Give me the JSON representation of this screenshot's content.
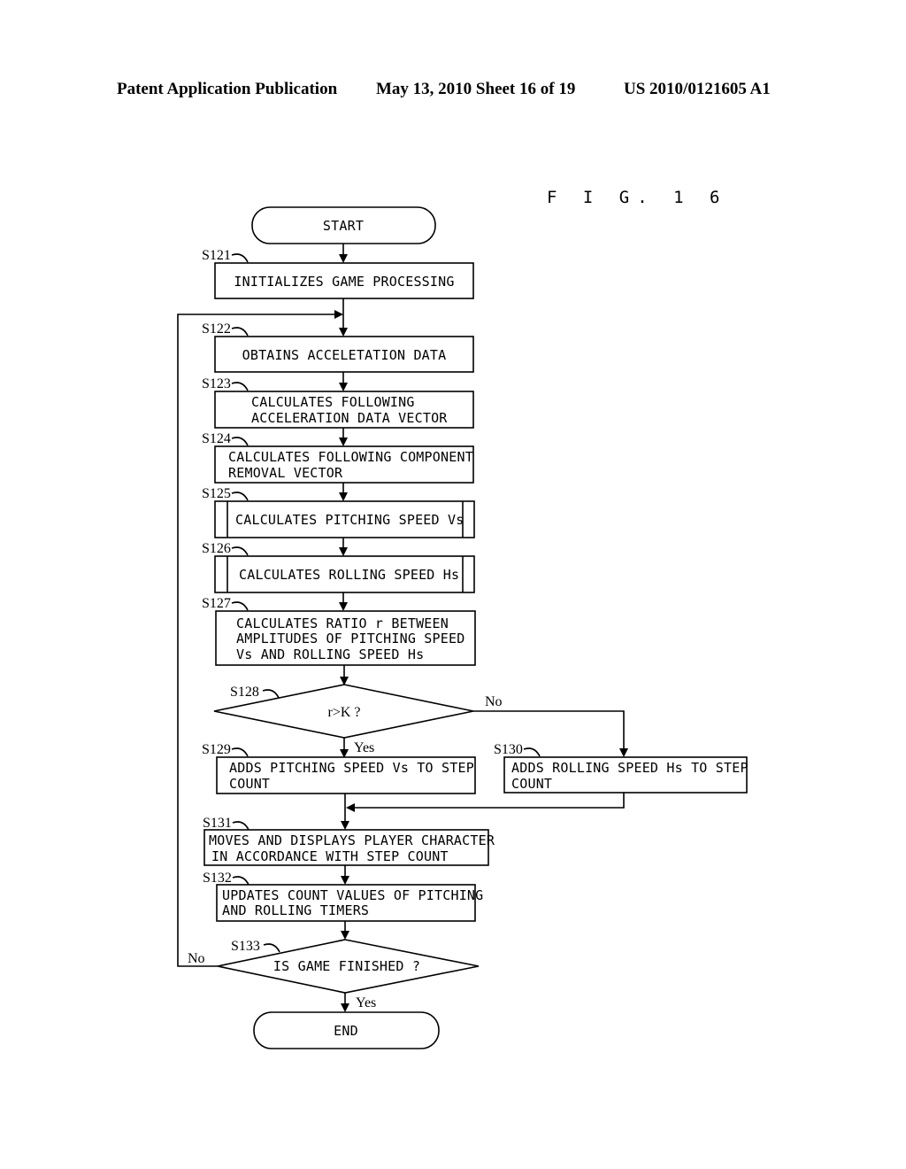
{
  "header": {
    "publication": "Patent Application Publication",
    "date_sheet": "May 13, 2010  Sheet 16 of 19",
    "number": "US 2010/0121605 A1"
  },
  "figure_label": "F I G. 1 6",
  "flowchart": {
    "start": "START",
    "end": "END",
    "steps": {
      "s121": {
        "id": "S121",
        "lines": [
          "INITIALIZES GAME PROCESSING"
        ]
      },
      "s122": {
        "id": "S122",
        "lines": [
          "OBTAINS ACCELETATION DATA"
        ]
      },
      "s123": {
        "id": "S123",
        "lines": [
          "CALCULATES FOLLOWING",
          "ACCELERATION DATA VECTOR"
        ]
      },
      "s124": {
        "id": "S124",
        "lines": [
          "CALCULATES FOLLOWING COMPONENT",
          "REMOVAL VECTOR"
        ]
      },
      "s125": {
        "id": "S125",
        "lines": [
          "CALCULATES PITCHING SPEED Vs"
        ]
      },
      "s126": {
        "id": "S126",
        "lines": [
          "CALCULATES ROLLING SPEED Hs"
        ]
      },
      "s127": {
        "id": "S127",
        "lines": [
          "CALCULATES RATIO r BETWEEN",
          "AMPLITUDES OF PITCHING SPEED",
          "Vs AND ROLLING SPEED Hs"
        ]
      },
      "s128": {
        "id": "S128",
        "lines": [
          "r>K ?"
        ]
      },
      "s129": {
        "id": "S129",
        "lines": [
          "ADDS PITCHING SPEED Vs TO STEP",
          "COUNT"
        ]
      },
      "s130": {
        "id": "S130",
        "lines": [
          "ADDS ROLLING SPEED Hs TO STEP",
          "COUNT"
        ]
      },
      "s131": {
        "id": "S131",
        "lines": [
          "MOVES AND DISPLAYS PLAYER CHARACTER",
          "IN ACCORDANCE WITH STEP COUNT"
        ]
      },
      "s132": {
        "id": "S132",
        "lines": [
          "UPDATES COUNT VALUES OF PITCHING",
          "AND ROLLING TIMERS"
        ]
      },
      "s133": {
        "id": "S133",
        "lines": [
          "IS GAME FINISHED ?"
        ]
      }
    },
    "branch_labels": {
      "s128_yes": "Yes",
      "s128_no": "No",
      "s133_yes": "Yes",
      "s133_no": "No"
    }
  }
}
